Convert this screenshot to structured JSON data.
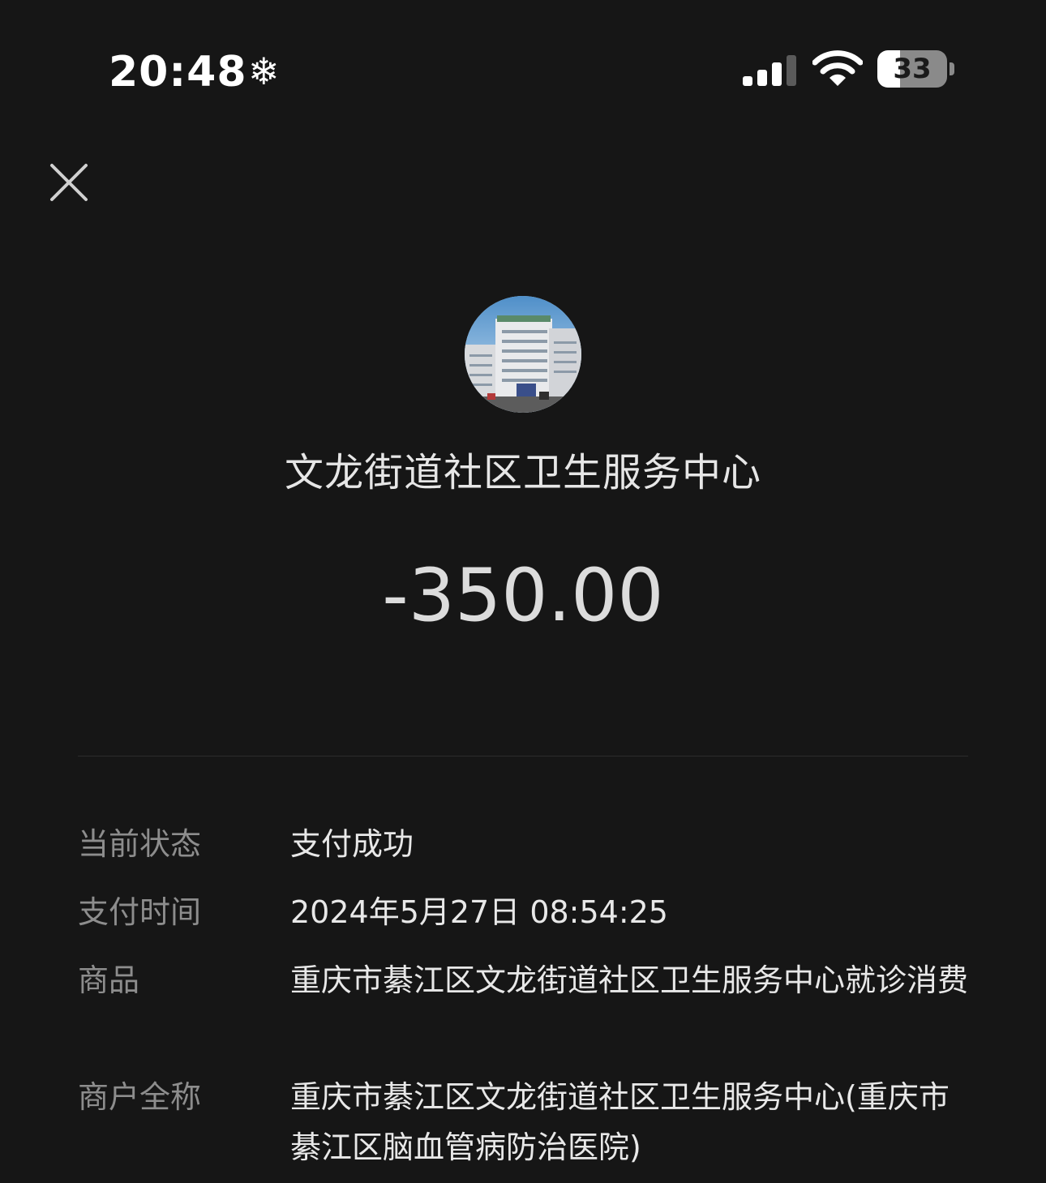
{
  "status_bar": {
    "time": "20:48",
    "snow_glyph": "❄",
    "battery": "33",
    "battery_level": 0.33,
    "signal_icon": "signal-icon",
    "wifi_icon": "wifi-icon"
  },
  "header": {
    "close_icon": "close-icon",
    "merchant_name": "文龙街道社区卫生服务中心",
    "amount": "-350.00",
    "avatar": "merchant-avatar"
  },
  "details": [
    {
      "label": "当前状态",
      "value": "支付成功"
    },
    {
      "label": "支付时间",
      "value": "2024年5月27日 08:54:25"
    },
    {
      "label": "商品",
      "value": "重庆市綦江区文龙街道社区卫生服务中心就诊消费"
    },
    {
      "label": "商户全称",
      "value": "重庆市綦江区文龙街道社区卫生服务中心(重庆市綦江区脑血管病防治医院)"
    }
  ],
  "colors": {
    "background": "#161616",
    "label": "#8d8d8d",
    "value": "#e8e8e8"
  }
}
